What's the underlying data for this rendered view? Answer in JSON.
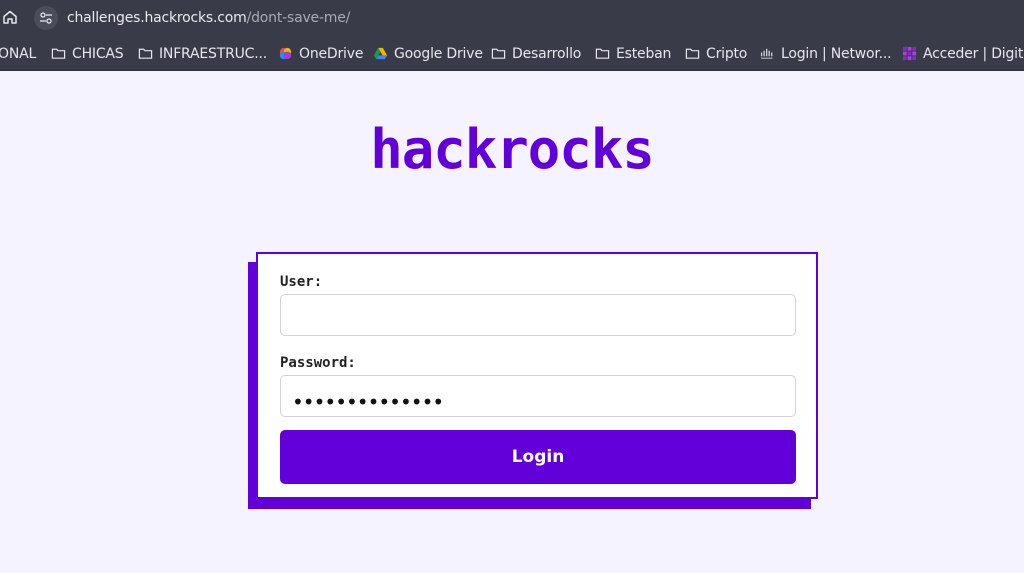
{
  "browser": {
    "url_host": "challenges.hackrocks.com",
    "url_path": "/dont-save-me/",
    "bookmarks": [
      {
        "label": "ONAL",
        "icon": "none"
      },
      {
        "label": "CHICAS",
        "icon": "folder-icon"
      },
      {
        "label": "INFRAESTRUC...",
        "icon": "folder-icon"
      },
      {
        "label": "OneDrive",
        "icon": "onedrive-icon"
      },
      {
        "label": "Google Drive",
        "icon": "google-drive-icon"
      },
      {
        "label": "Desarrollo",
        "icon": "folder-icon"
      },
      {
        "label": "Esteban",
        "icon": "folder-icon"
      },
      {
        "label": "Cripto",
        "icon": "folder-icon"
      },
      {
        "label": "Login | Networ...",
        "icon": "cisco-icon"
      },
      {
        "label": "Acceder | Digit...",
        "icon": "digit-icon"
      }
    ]
  },
  "page": {
    "logo": "hackrocks"
  },
  "login_form": {
    "user_label": "User:",
    "user_value": "",
    "password_label": "Password:",
    "password_mask": "••••••••••••••",
    "submit_label": "Login"
  },
  "colors": {
    "accent": "#6200d9",
    "page_bg": "#f5f3ff",
    "chrome_bg": "#3a3b48"
  }
}
